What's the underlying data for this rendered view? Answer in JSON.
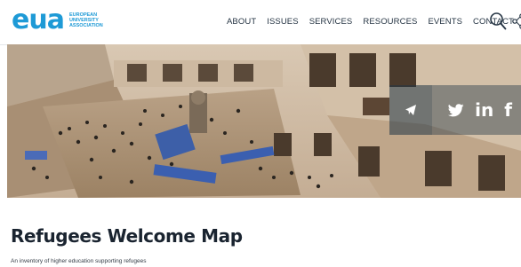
{
  "header": {
    "logo": {
      "mark": "eua",
      "lines": [
        "EUROPEAN",
        "UNIVERSITY",
        "ASSOCIATION"
      ]
    },
    "nav": [
      "ABOUT",
      "ISSUES",
      "SERVICES",
      "RESOURCES",
      "EVENTS",
      "CONTACT"
    ],
    "icons": [
      "search-icon",
      "share-icon"
    ]
  },
  "hero": {
    "social": {
      "telegram_icon": "telegram-icon",
      "twitter_icon": "twitter-icon",
      "linkedin_label": "in",
      "facebook_label": "f"
    }
  },
  "main": {
    "title": "Refugees Welcome Map",
    "subtitle": "An inventory of higher education supporting refugees"
  },
  "colors": {
    "brand_blue": "#1e9ad6",
    "nav_text": "#263544",
    "title_text": "#1a2430"
  }
}
